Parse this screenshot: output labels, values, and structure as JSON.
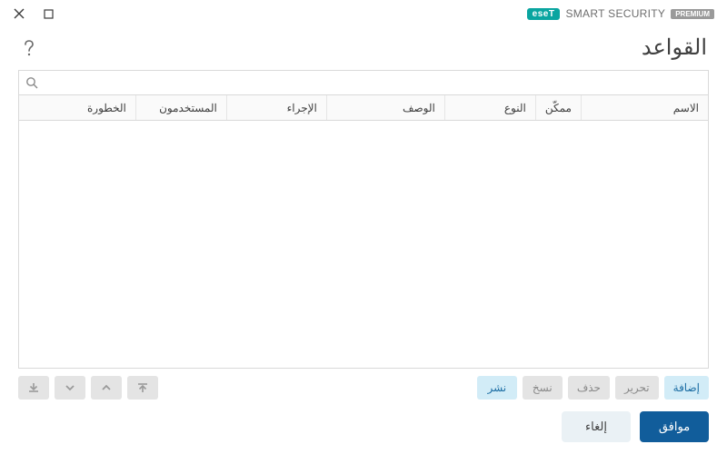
{
  "brand": {
    "eset": "eseT",
    "product": "SMART SECURITY",
    "tier": "PREMIUM"
  },
  "header": {
    "title": "القواعد"
  },
  "search": {
    "placeholder": ""
  },
  "table": {
    "columns": [
      "الاسم",
      "ممكّن",
      "النوع",
      "الوصف",
      "الإجراء",
      "المستخدمون",
      "الخطورة"
    ],
    "rows": []
  },
  "actions": {
    "add": "إضافة",
    "edit": "تحرير",
    "delete": "حذف",
    "copy": "نسخ",
    "deploy": "نشر"
  },
  "footer": {
    "ok": "موافق",
    "cancel": "إلغاء"
  },
  "colors": {
    "accent": "#115d9b",
    "teal": "#0aa5a0",
    "lightblue": "#d2ecf7"
  }
}
